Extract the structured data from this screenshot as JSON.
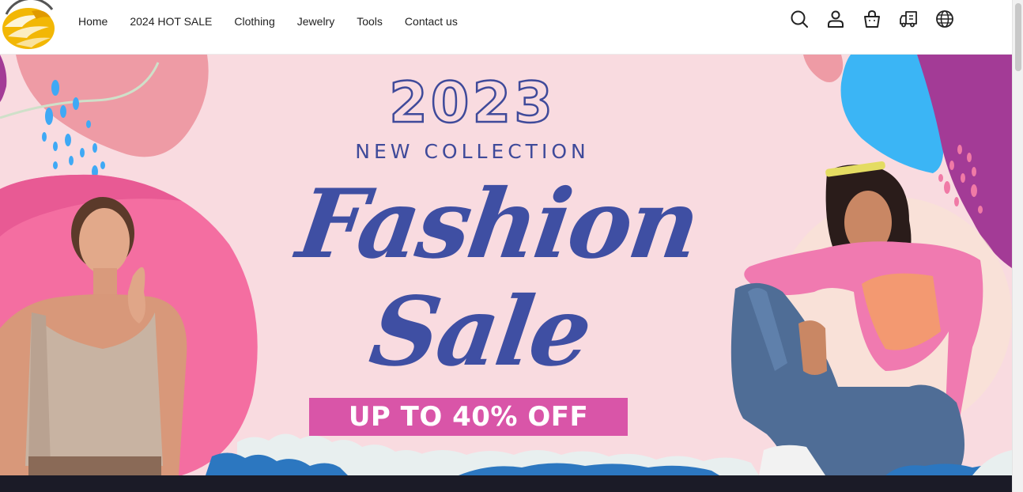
{
  "brand": {
    "logo_icon": "eagle-logo-icon",
    "colors": {
      "gold": "#f2b705",
      "navy": "#3f4a9a",
      "pink": "#d955a8"
    }
  },
  "nav": {
    "items": [
      {
        "label": "Home"
      },
      {
        "label": "2024 HOT SALE"
      },
      {
        "label": "Clothing"
      },
      {
        "label": "Jewelry"
      },
      {
        "label": "Tools"
      },
      {
        "label": "Contact us"
      }
    ]
  },
  "header_icons": [
    "search-icon",
    "account-icon",
    "cart-icon",
    "shipping-truck-icon",
    "globe-icon"
  ],
  "banner": {
    "year": "2023",
    "subtitle": "NEW COLLECTION",
    "headline_line1": "Fashion",
    "headline_line2": "Sale",
    "promo": "UP TO 40% OFF"
  }
}
